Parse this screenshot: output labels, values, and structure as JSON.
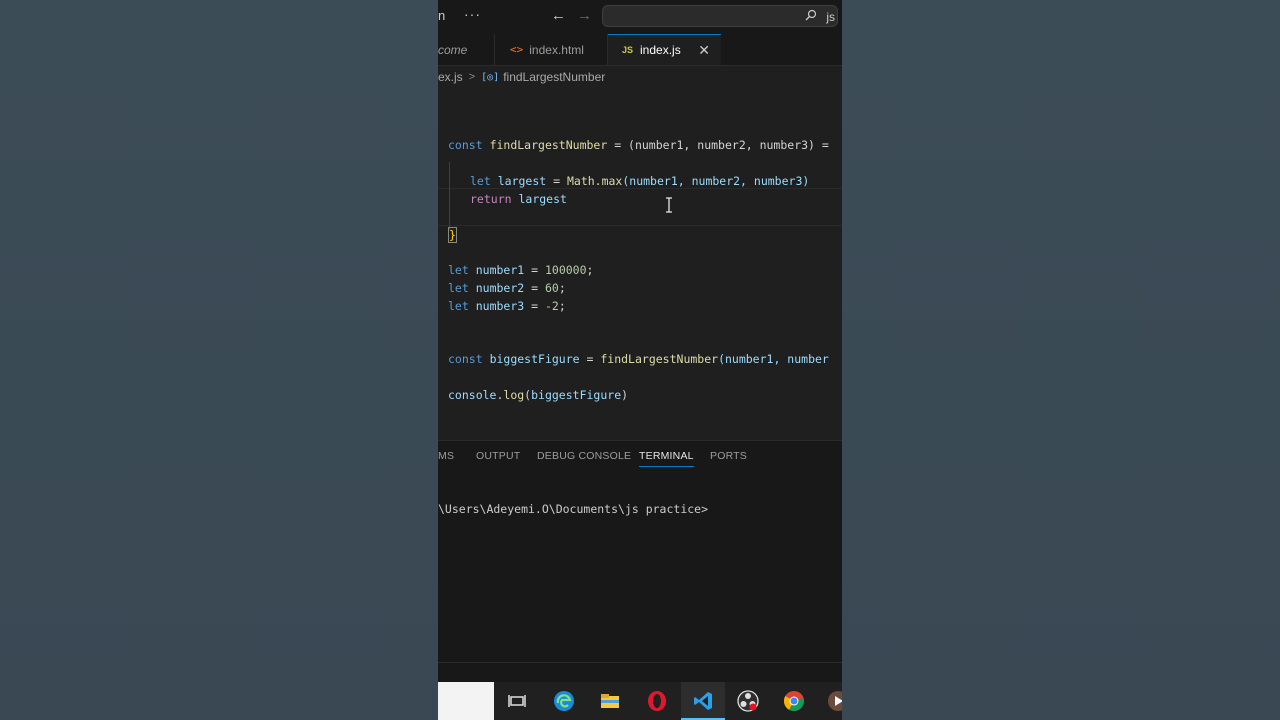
{
  "titlebar": {
    "menu_fragment": "n",
    "more": "···",
    "back": "←",
    "forward": "→",
    "search_icon": "search-icon",
    "search_text": "js"
  },
  "tabs": [
    {
      "label": "come",
      "icon": "none"
    },
    {
      "label": "index.html",
      "icon": "html-file-icon"
    },
    {
      "label": "index.js",
      "icon": "js-file-icon",
      "active": true,
      "close": "✕"
    }
  ],
  "breadcrumb": {
    "file": "ex.js",
    "separator": ">",
    "symbol": "findLargestNumber"
  },
  "code": {
    "l1": {
      "kw": "const",
      "name": "findLargestNumber",
      "rest": " = (number1, number2, number3) ="
    },
    "l2": {
      "kw": "let",
      "name": "largest",
      "eq": " = ",
      "fn": "Math.max",
      "args": "(number1, number2, number3)"
    },
    "l3": {
      "kw": "return",
      "name": "largest"
    },
    "l4": "}",
    "l5": {
      "kw": "let",
      "name": "number1",
      "eq": " = ",
      "val": "100000",
      ";": ";"
    },
    "l6": {
      "kw": "let",
      "name": "number2",
      "eq": " = ",
      "val": "60",
      ";": ";"
    },
    "l7": {
      "kw": "let",
      "name": "number3",
      "eq": " = ",
      "val": "-2",
      ";": ";"
    },
    "l8": {
      "kw": "const",
      "name": "biggestFigure",
      "eq": " = ",
      "fn": "findLargestNumber",
      "args": "(number1, number"
    },
    "l9": {
      "obj": "console",
      "fn": ".log",
      "open": "(",
      "arg": "biggestFigure",
      "close": ")"
    }
  },
  "panel": {
    "tabs": [
      "MS",
      "OUTPUT",
      "DEBUG CONSOLE",
      "TERMINAL",
      "PORTS"
    ],
    "active_tab": "TERMINAL",
    "terminal_prompt": "\\Users\\Adeyemi.O\\Documents\\js practice>"
  },
  "taskbar": {
    "icons": [
      "task-view-icon",
      "edge-icon",
      "file-explorer-icon",
      "opera-icon",
      "vscode-icon",
      "obs-icon",
      "chrome-icon",
      "media-icon"
    ],
    "active": "vscode-icon"
  }
}
